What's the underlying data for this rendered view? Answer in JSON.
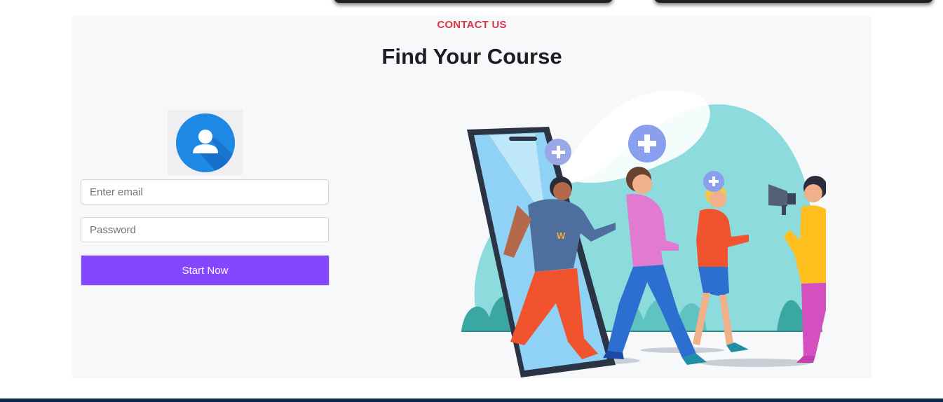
{
  "section": {
    "eyebrow": "CONTACT US",
    "title": "Find Your Course"
  },
  "form": {
    "email_placeholder": "Enter email",
    "password_placeholder": "Password",
    "submit_label": "Start Now"
  },
  "illustration": {
    "phone_logo_text": "W"
  },
  "icons": {
    "avatar": "user-avatar-icon",
    "plus": "plus-circle-icon",
    "megaphone": "megaphone-icon"
  },
  "colors": {
    "accent": "#8447ff",
    "eyebrow": "#dc3545",
    "title": "#1c1d22",
    "avatar_blue": "#1e88e5",
    "footer": "#0e2a4f"
  }
}
